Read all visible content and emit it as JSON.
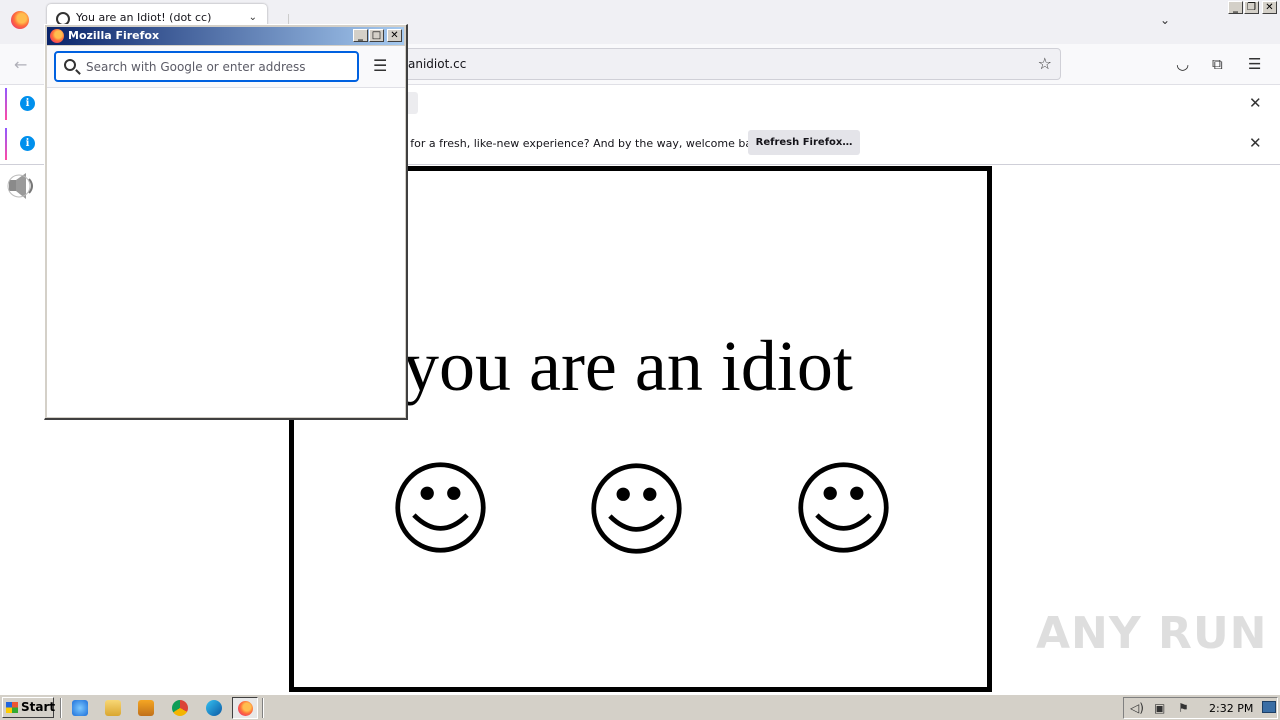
{
  "browser": {
    "tab_title": "You are an Idiot! (dot cc)",
    "url": "anidiot.cc",
    "notifications": [
      {
        "message": "",
        "close": "✕"
      },
      {
        "message": "o for a fresh, like-new experience? And by the way, welcome back!",
        "button": "Refresh Firefox…",
        "close": "✕"
      }
    ],
    "icons": {
      "back": "back-arrow-icon",
      "bookmark": "star-icon",
      "pocket": "pocket-icon",
      "extensions": "puzzle-icon",
      "menu": "hamburger-menu-icon"
    },
    "window_controls": [
      "_",
      "❐",
      "✕"
    ],
    "accent": "#0061e0"
  },
  "page": {
    "headline": "you are an idiot",
    "smiley_count": 3
  },
  "popup": {
    "title": "Mozilla Firefox",
    "search_placeholder": "Search with Google or enter address",
    "window_controls": [
      "_",
      "□",
      "✕"
    ]
  },
  "watermark": "ANY RUN",
  "taskbar": {
    "start_label": "Start",
    "quick_launch": [
      "ie-icon",
      "explorer-icon",
      "media-player-icon",
      "chrome-icon",
      "edge-icon"
    ],
    "active_app": "firefox-icon",
    "clock": "2:32 PM"
  }
}
